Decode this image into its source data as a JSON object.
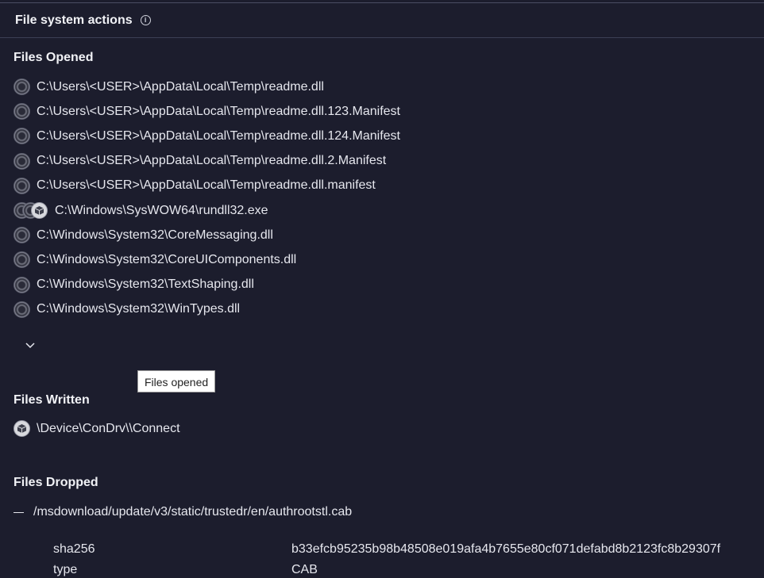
{
  "header": {
    "title": "File system actions"
  },
  "files_opened": {
    "title": "Files Opened",
    "items": [
      {
        "path": "C:\\Users\\<USER>\\AppData\\Local\\Temp\\readme.dll"
      },
      {
        "path": "C:\\Users\\<USER>\\AppData\\Local\\Temp\\readme.dll.123.Manifest"
      },
      {
        "path": "C:\\Users\\<USER>\\AppData\\Local\\Temp\\readme.dll.124.Manifest"
      },
      {
        "path": "C:\\Users\\<USER>\\AppData\\Local\\Temp\\readme.dll.2.Manifest"
      },
      {
        "path": "C:\\Users\\<USER>\\AppData\\Local\\Temp\\readme.dll.manifest"
      },
      {
        "path": "C:\\Windows\\SysWOW64\\rundll32.exe"
      },
      {
        "path": "C:\\Windows\\System32\\CoreMessaging.dll"
      },
      {
        "path": "C:\\Windows\\System32\\CoreUIComponents.dll"
      },
      {
        "path": "C:\\Windows\\System32\\TextShaping.dll"
      },
      {
        "path": "C:\\Windows\\System32\\WinTypes.dll"
      }
    ],
    "tooltip": "Files opened"
  },
  "files_written": {
    "title": "Files Written",
    "items": [
      {
        "path": "\\Device\\ConDrv\\\\Connect"
      }
    ]
  },
  "files_dropped": {
    "title": "Files Dropped",
    "item": {
      "path": "/msdownload/update/v3/static/trustedr/en/authrootstl.cab",
      "sha256_label": "sha256",
      "sha256": "b33efcb95235b98b48508e019afa4b7655e80cf071defabd8b2123fc8b29307f",
      "type_label": "type",
      "type": "CAB"
    }
  },
  "colors": {
    "background": "#1c1d2d",
    "text": "#e6e7ee"
  }
}
